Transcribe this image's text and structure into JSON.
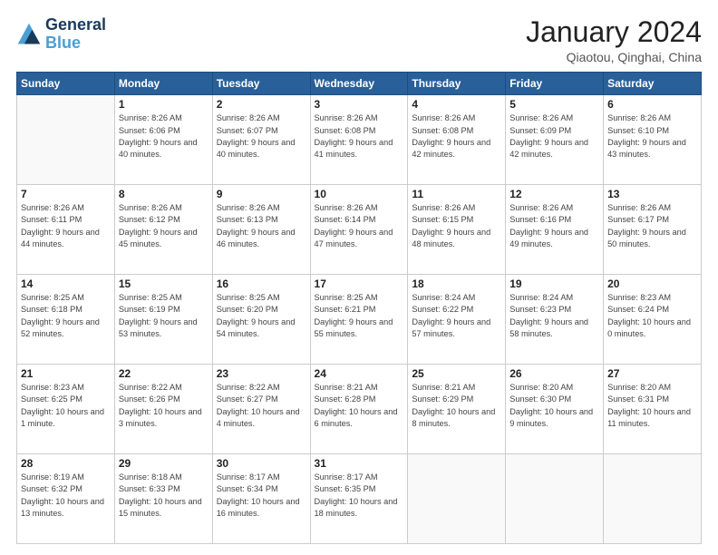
{
  "header": {
    "logo_line1": "General",
    "logo_line2": "Blue",
    "title": "January 2024",
    "subtitle": "Qiaotou, Qinghai, China"
  },
  "days_of_week": [
    "Sunday",
    "Monday",
    "Tuesday",
    "Wednesday",
    "Thursday",
    "Friday",
    "Saturday"
  ],
  "weeks": [
    [
      {
        "num": "",
        "sunrise": "",
        "sunset": "",
        "daylight": ""
      },
      {
        "num": "1",
        "sunrise": "Sunrise: 8:26 AM",
        "sunset": "Sunset: 6:06 PM",
        "daylight": "Daylight: 9 hours and 40 minutes."
      },
      {
        "num": "2",
        "sunrise": "Sunrise: 8:26 AM",
        "sunset": "Sunset: 6:07 PM",
        "daylight": "Daylight: 9 hours and 40 minutes."
      },
      {
        "num": "3",
        "sunrise": "Sunrise: 8:26 AM",
        "sunset": "Sunset: 6:08 PM",
        "daylight": "Daylight: 9 hours and 41 minutes."
      },
      {
        "num": "4",
        "sunrise": "Sunrise: 8:26 AM",
        "sunset": "Sunset: 6:08 PM",
        "daylight": "Daylight: 9 hours and 42 minutes."
      },
      {
        "num": "5",
        "sunrise": "Sunrise: 8:26 AM",
        "sunset": "Sunset: 6:09 PM",
        "daylight": "Daylight: 9 hours and 42 minutes."
      },
      {
        "num": "6",
        "sunrise": "Sunrise: 8:26 AM",
        "sunset": "Sunset: 6:10 PM",
        "daylight": "Daylight: 9 hours and 43 minutes."
      }
    ],
    [
      {
        "num": "7",
        "sunrise": "Sunrise: 8:26 AM",
        "sunset": "Sunset: 6:11 PM",
        "daylight": "Daylight: 9 hours and 44 minutes."
      },
      {
        "num": "8",
        "sunrise": "Sunrise: 8:26 AM",
        "sunset": "Sunset: 6:12 PM",
        "daylight": "Daylight: 9 hours and 45 minutes."
      },
      {
        "num": "9",
        "sunrise": "Sunrise: 8:26 AM",
        "sunset": "Sunset: 6:13 PM",
        "daylight": "Daylight: 9 hours and 46 minutes."
      },
      {
        "num": "10",
        "sunrise": "Sunrise: 8:26 AM",
        "sunset": "Sunset: 6:14 PM",
        "daylight": "Daylight: 9 hours and 47 minutes."
      },
      {
        "num": "11",
        "sunrise": "Sunrise: 8:26 AM",
        "sunset": "Sunset: 6:15 PM",
        "daylight": "Daylight: 9 hours and 48 minutes."
      },
      {
        "num": "12",
        "sunrise": "Sunrise: 8:26 AM",
        "sunset": "Sunset: 6:16 PM",
        "daylight": "Daylight: 9 hours and 49 minutes."
      },
      {
        "num": "13",
        "sunrise": "Sunrise: 8:26 AM",
        "sunset": "Sunset: 6:17 PM",
        "daylight": "Daylight: 9 hours and 50 minutes."
      }
    ],
    [
      {
        "num": "14",
        "sunrise": "Sunrise: 8:25 AM",
        "sunset": "Sunset: 6:18 PM",
        "daylight": "Daylight: 9 hours and 52 minutes."
      },
      {
        "num": "15",
        "sunrise": "Sunrise: 8:25 AM",
        "sunset": "Sunset: 6:19 PM",
        "daylight": "Daylight: 9 hours and 53 minutes."
      },
      {
        "num": "16",
        "sunrise": "Sunrise: 8:25 AM",
        "sunset": "Sunset: 6:20 PM",
        "daylight": "Daylight: 9 hours and 54 minutes."
      },
      {
        "num": "17",
        "sunrise": "Sunrise: 8:25 AM",
        "sunset": "Sunset: 6:21 PM",
        "daylight": "Daylight: 9 hours and 55 minutes."
      },
      {
        "num": "18",
        "sunrise": "Sunrise: 8:24 AM",
        "sunset": "Sunset: 6:22 PM",
        "daylight": "Daylight: 9 hours and 57 minutes."
      },
      {
        "num": "19",
        "sunrise": "Sunrise: 8:24 AM",
        "sunset": "Sunset: 6:23 PM",
        "daylight": "Daylight: 9 hours and 58 minutes."
      },
      {
        "num": "20",
        "sunrise": "Sunrise: 8:23 AM",
        "sunset": "Sunset: 6:24 PM",
        "daylight": "Daylight: 10 hours and 0 minutes."
      }
    ],
    [
      {
        "num": "21",
        "sunrise": "Sunrise: 8:23 AM",
        "sunset": "Sunset: 6:25 PM",
        "daylight": "Daylight: 10 hours and 1 minute."
      },
      {
        "num": "22",
        "sunrise": "Sunrise: 8:22 AM",
        "sunset": "Sunset: 6:26 PM",
        "daylight": "Daylight: 10 hours and 3 minutes."
      },
      {
        "num": "23",
        "sunrise": "Sunrise: 8:22 AM",
        "sunset": "Sunset: 6:27 PM",
        "daylight": "Daylight: 10 hours and 4 minutes."
      },
      {
        "num": "24",
        "sunrise": "Sunrise: 8:21 AM",
        "sunset": "Sunset: 6:28 PM",
        "daylight": "Daylight: 10 hours and 6 minutes."
      },
      {
        "num": "25",
        "sunrise": "Sunrise: 8:21 AM",
        "sunset": "Sunset: 6:29 PM",
        "daylight": "Daylight: 10 hours and 8 minutes."
      },
      {
        "num": "26",
        "sunrise": "Sunrise: 8:20 AM",
        "sunset": "Sunset: 6:30 PM",
        "daylight": "Daylight: 10 hours and 9 minutes."
      },
      {
        "num": "27",
        "sunrise": "Sunrise: 8:20 AM",
        "sunset": "Sunset: 6:31 PM",
        "daylight": "Daylight: 10 hours and 11 minutes."
      }
    ],
    [
      {
        "num": "28",
        "sunrise": "Sunrise: 8:19 AM",
        "sunset": "Sunset: 6:32 PM",
        "daylight": "Daylight: 10 hours and 13 minutes."
      },
      {
        "num": "29",
        "sunrise": "Sunrise: 8:18 AM",
        "sunset": "Sunset: 6:33 PM",
        "daylight": "Daylight: 10 hours and 15 minutes."
      },
      {
        "num": "30",
        "sunrise": "Sunrise: 8:17 AM",
        "sunset": "Sunset: 6:34 PM",
        "daylight": "Daylight: 10 hours and 16 minutes."
      },
      {
        "num": "31",
        "sunrise": "Sunrise: 8:17 AM",
        "sunset": "Sunset: 6:35 PM",
        "daylight": "Daylight: 10 hours and 18 minutes."
      },
      {
        "num": "",
        "sunrise": "",
        "sunset": "",
        "daylight": ""
      },
      {
        "num": "",
        "sunrise": "",
        "sunset": "",
        "daylight": ""
      },
      {
        "num": "",
        "sunrise": "",
        "sunset": "",
        "daylight": ""
      }
    ]
  ]
}
